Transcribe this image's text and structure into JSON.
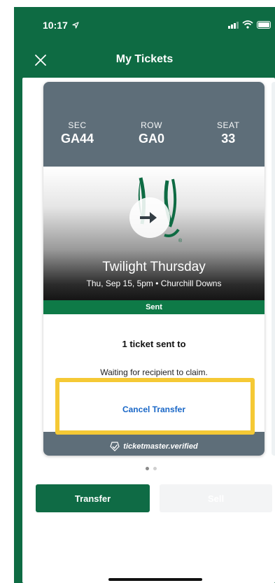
{
  "status_bar": {
    "time": "10:17",
    "location_icon": "location-arrow-icon",
    "signal_icon": "cellular-signal-icon",
    "wifi_icon": "wifi-icon",
    "battery_icon": "battery-icon"
  },
  "nav": {
    "title": "My Tickets",
    "close_icon": "close-icon"
  },
  "ticket": {
    "sec_label": "SEC",
    "sec_value": "GA44",
    "row_label": "ROW",
    "row_value": "GA0",
    "seat_label": "SEAT",
    "seat_value": "33",
    "event_title": "Twilight Thursday",
    "event_subtitle": "Thu, Sep 15, 5pm • Churchill Downs",
    "status": "Sent",
    "sent_message": "1 ticket sent to",
    "waiting_message": "Waiting for recipient to claim.",
    "cancel_label": "Cancel Transfer",
    "verified_label": "ticketmaster.verified"
  },
  "pager": {
    "count": 2,
    "active_index": 0
  },
  "actions": {
    "transfer_label": "Transfer",
    "sell_label": "Sell"
  },
  "colors": {
    "brand_green": "#0e6b43",
    "slate": "#5e6e79",
    "sent_green": "#0e7a47",
    "link_blue": "#1967c7",
    "highlight_yellow": "#f5c935"
  }
}
